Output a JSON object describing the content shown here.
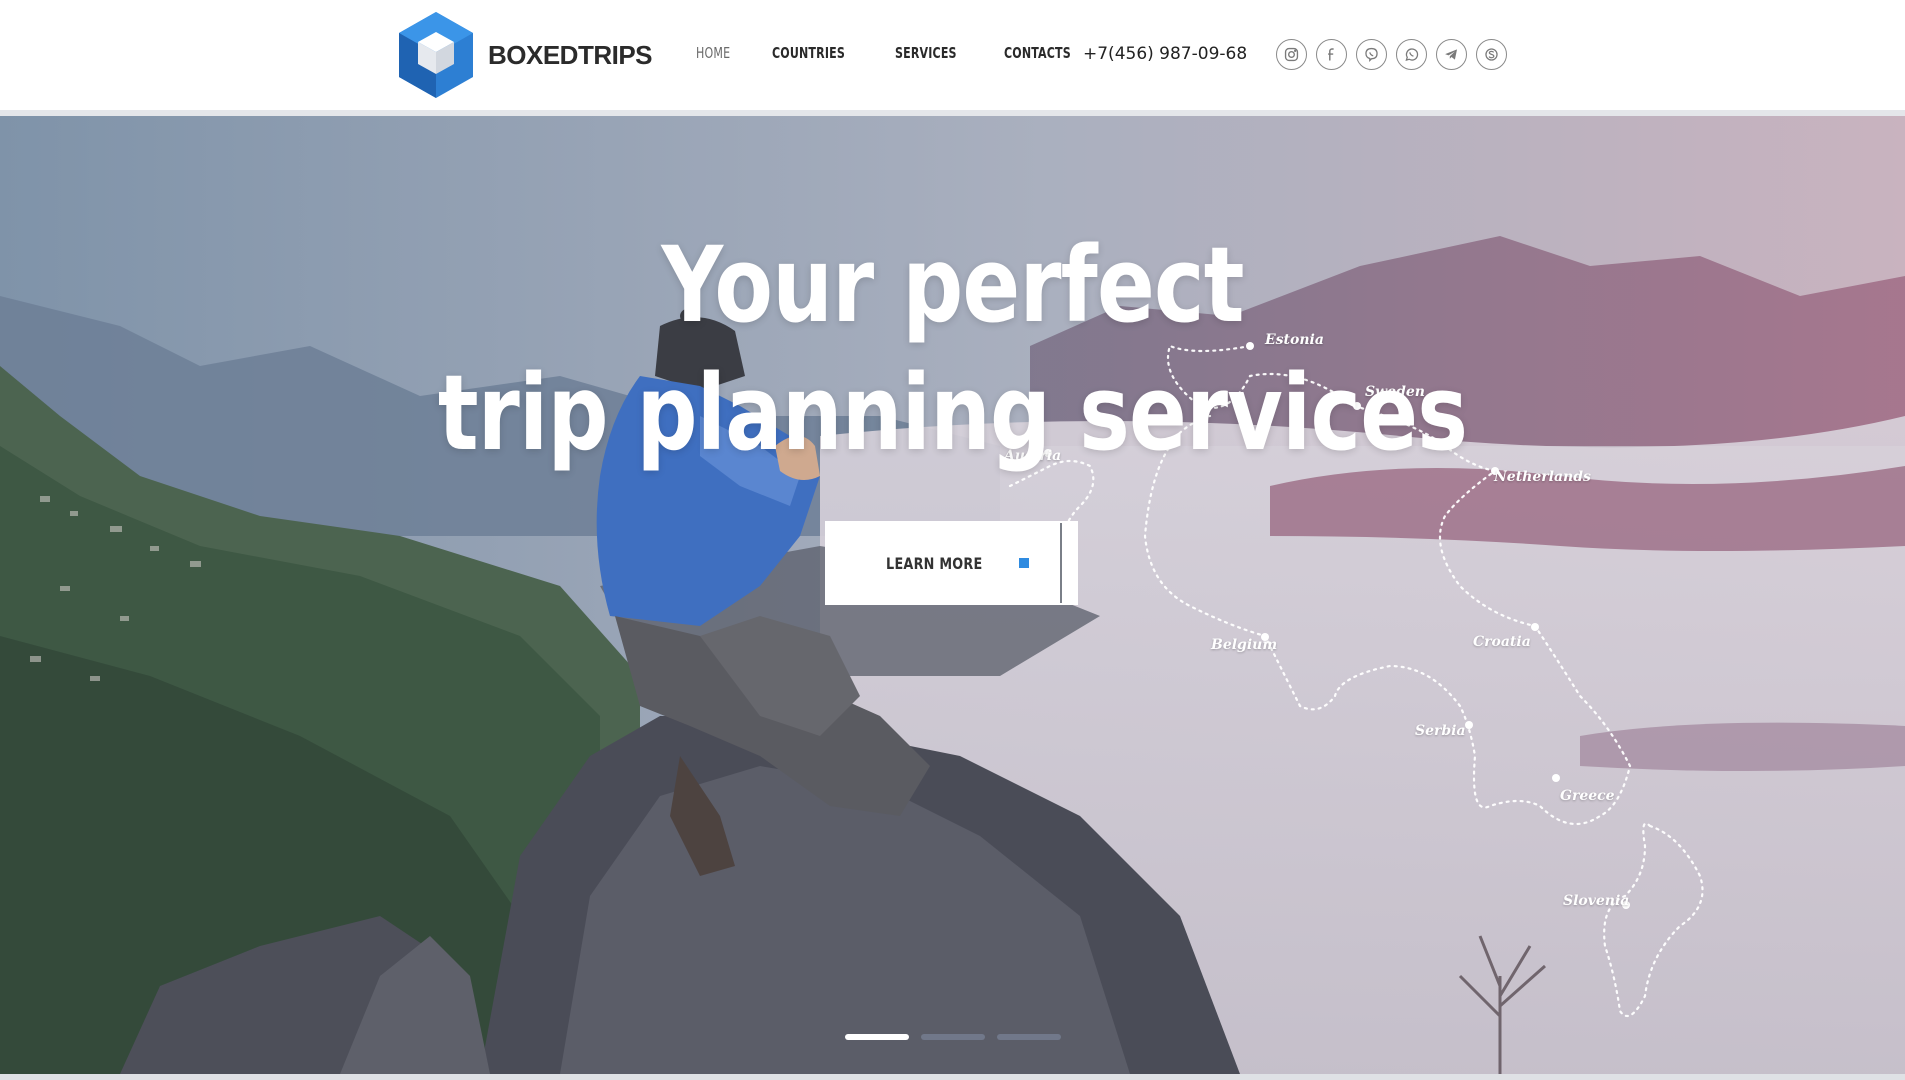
{
  "brand": {
    "name": "BOXEDTRIPS",
    "logo_icon": "cube-logo-icon",
    "accent_color": "#2f8be0"
  },
  "nav": {
    "items": [
      {
        "label": "HOME",
        "active": true
      },
      {
        "label": "COUNTRIES",
        "active": false
      },
      {
        "label": "SERVICES",
        "active": false
      },
      {
        "label": "CONTACTS",
        "active": false
      }
    ]
  },
  "contact": {
    "phone": "+7(456) 987-09-68"
  },
  "socials": [
    {
      "icon": "instagram-icon"
    },
    {
      "icon": "facebook-icon"
    },
    {
      "icon": "viber-icon"
    },
    {
      "icon": "whatsapp-icon"
    },
    {
      "icon": "telegram-icon"
    },
    {
      "icon": "skype-icon"
    }
  ],
  "hero": {
    "title_line1": "Your perfect",
    "title_line2": "trip planning services",
    "cta_label": "LEARN MORE",
    "map_labels": [
      "Estonia",
      "Sweden",
      "Netherlands",
      "Belgium",
      "Croatia",
      "Serbia",
      "Greece",
      "Slovenia",
      "Austria"
    ]
  },
  "slider": {
    "count": 3,
    "active_index": 0
  }
}
